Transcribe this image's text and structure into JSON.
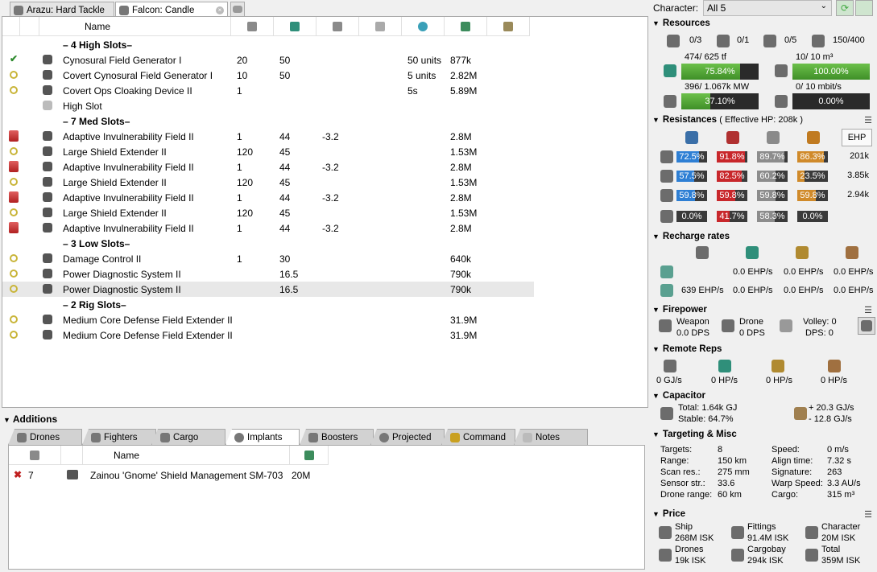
{
  "tabs": [
    {
      "label": "Arazu: Hard Tackle",
      "active": false
    },
    {
      "label": "Falcon: Candle",
      "active": true
    }
  ],
  "fitting": {
    "name_header": "Name",
    "header_icons": [
      "cpu-icon",
      "powergrid-icon",
      "capacitor-icon",
      "speed-icon",
      "range-icon",
      "price-icon",
      "falloff-icon"
    ],
    "rows": [
      {
        "type": "rack",
        "name": "– 4 High Slots–"
      },
      {
        "state": "online-check",
        "name": "Cynosural Field Generator I",
        "c1": "20",
        "c2": "50",
        "c3": "",
        "c5": "50 units",
        "c6": "877k"
      },
      {
        "state": "online",
        "name": "Covert Cynosural Field Generator I",
        "c1": "10",
        "c2": "50",
        "c3": "",
        "c5": "5 units",
        "c6": "2.82M"
      },
      {
        "state": "online",
        "name": "Covert Ops Cloaking Device II",
        "c1": "1",
        "c2": "",
        "c3": "",
        "c5": "5s",
        "c6": "5.89M"
      },
      {
        "state": "",
        "name": "High Slot",
        "c1": "",
        "c2": "",
        "c3": "",
        "c5": "",
        "c6": "",
        "empty": true
      },
      {
        "type": "rack",
        "name": "– 7 Med Slots–"
      },
      {
        "state": "overheat",
        "name": "Adaptive Invulnerability Field II",
        "c1": "1",
        "c2": "44",
        "c3": "-3.2",
        "c5": "",
        "c6": "2.8M"
      },
      {
        "state": "online",
        "name": "Large Shield Extender II",
        "c1": "120",
        "c2": "45",
        "c3": "",
        "c5": "",
        "c6": "1.53M"
      },
      {
        "state": "overheat",
        "name": "Adaptive Invulnerability Field II",
        "c1": "1",
        "c2": "44",
        "c3": "-3.2",
        "c5": "",
        "c6": "2.8M"
      },
      {
        "state": "online",
        "name": "Large Shield Extender II",
        "c1": "120",
        "c2": "45",
        "c3": "",
        "c5": "",
        "c6": "1.53M"
      },
      {
        "state": "overheat",
        "name": "Adaptive Invulnerability Field II",
        "c1": "1",
        "c2": "44",
        "c3": "-3.2",
        "c5": "",
        "c6": "2.8M"
      },
      {
        "state": "online",
        "name": "Large Shield Extender II",
        "c1": "120",
        "c2": "45",
        "c3": "",
        "c5": "",
        "c6": "1.53M"
      },
      {
        "state": "overheat",
        "name": "Adaptive Invulnerability Field II",
        "c1": "1",
        "c2": "44",
        "c3": "-3.2",
        "c5": "",
        "c6": "2.8M"
      },
      {
        "type": "rack",
        "name": "– 3 Low Slots–"
      },
      {
        "state": "online",
        "name": "Damage Control II",
        "c1": "1",
        "c2": "30",
        "c3": "",
        "c5": "",
        "c6": "640k"
      },
      {
        "state": "online",
        "name": "Power Diagnostic System II",
        "c1": "",
        "c2": "16.5",
        "c3": "",
        "c5": "",
        "c6": "790k"
      },
      {
        "state": "online",
        "name": "Power Diagnostic System II",
        "c1": "",
        "c2": "16.5",
        "c3": "",
        "c5": "",
        "c6": "790k",
        "selected": true
      },
      {
        "type": "rack",
        "name": "– 2 Rig Slots–"
      },
      {
        "state": "online",
        "name": "Medium Core Defense Field Extender II",
        "c1": "",
        "c2": "",
        "c3": "",
        "c5": "",
        "c6": "31.9M"
      },
      {
        "state": "online",
        "name": "Medium Core Defense Field Extender II",
        "c1": "",
        "c2": "",
        "c3": "",
        "c5": "",
        "c6": "31.9M"
      }
    ]
  },
  "additions": {
    "title": "Additions",
    "tabs": [
      "Drones",
      "Fighters",
      "Cargo",
      "Implants",
      "Boosters",
      "Projected",
      "Command",
      "Notes"
    ],
    "active_tab": "Implants",
    "implants_header": {
      "name": "Name"
    },
    "implants": [
      {
        "slot": "7",
        "name": "Zainou 'Gnome' Shield Management SM-703",
        "price": "20M"
      }
    ]
  },
  "character": {
    "label": "Character:",
    "value": "All 5"
  },
  "resources": {
    "title": "Resources",
    "hardpoints": [
      "0/3",
      "0/1",
      "0/5",
      "150/400"
    ],
    "cpu": {
      "text": "474/ 625 tf",
      "pct": "75.84%",
      "fill": 0.7584
    },
    "drone_bay": {
      "text": "10/ 10 m³",
      "pct": "100.00%",
      "fill": 1.0
    },
    "powergrid": {
      "text": "396/ 1.067k MW",
      "pct": "37.10%",
      "fill": 0.371
    },
    "bandwidth": {
      "text": "0/ 10 mbit/s",
      "pct": "0.00%",
      "fill": 0.0
    }
  },
  "resistances": {
    "title": "Resistances",
    "ehp_note": "( Effective HP: 208k )",
    "ehp_button": "EHP",
    "rows": [
      {
        "vals": [
          "72.5%",
          "91.8%",
          "89.7%",
          "86.3%"
        ],
        "fills": [
          0.725,
          0.918,
          0.897,
          0.863
        ],
        "hp": "201k"
      },
      {
        "vals": [
          "57.5%",
          "82.5%",
          "60.2%",
          "23.5%"
        ],
        "fills": [
          0.575,
          0.825,
          0.602,
          0.235
        ],
        "hp": "3.85k"
      },
      {
        "vals": [
          "59.8%",
          "59.8%",
          "59.8%",
          "59.8%"
        ],
        "fills": [
          0.598,
          0.598,
          0.598,
          0.598
        ],
        "hp": "2.94k"
      },
      {
        "vals": [
          "0.0%",
          "41.7%",
          "58.3%",
          "0.0%"
        ],
        "fills": [
          0,
          0.417,
          0.583,
          0
        ],
        "hp": ""
      }
    ],
    "colors": [
      "#2e7fd4",
      "#c8272b",
      "#8c8c8c",
      "#d08a2a"
    ]
  },
  "recharge": {
    "title": "Recharge rates",
    "row1": [
      "0.0 EHP/s",
      "0.0 EHP/s",
      "0.0 EHP/s"
    ],
    "row2": [
      "639 EHP/s",
      "0.0 EHP/s",
      "0.0 EHP/s",
      "0.0 EHP/s"
    ]
  },
  "firepower": {
    "title": "Firepower",
    "weapon_label": "Weapon",
    "weapon_dps": "0.0 DPS",
    "drone_label": "Drone",
    "drone_dps": "0 DPS",
    "volley": "Volley: 0",
    "dps": "DPS: 0"
  },
  "remote_reps": {
    "title": "Remote Reps",
    "values": [
      "0 GJ/s",
      "0 HP/s",
      "0 HP/s",
      "0 HP/s"
    ]
  },
  "capacitor": {
    "title": "Capacitor",
    "total": "Total: 1.64k GJ",
    "stable": "Stable: 64.7%",
    "plus": "+ 20.3 GJ/s",
    "minus": "- 12.8 GJ/s"
  },
  "targeting": {
    "title": "Targeting & Misc",
    "left": [
      [
        "Targets:",
        "8"
      ],
      [
        "Range:",
        "150 km"
      ],
      [
        "Scan res.:",
        "275 mm"
      ],
      [
        "Sensor str.:",
        "33.6"
      ],
      [
        "Drone range:",
        "60 km"
      ]
    ],
    "right": [
      [
        "Speed:",
        "0 m/s"
      ],
      [
        "Align time:",
        "7.32 s"
      ],
      [
        "Signature:",
        "263"
      ],
      [
        "Warp Speed:",
        "3.3 AU/s"
      ],
      [
        "Cargo:",
        "315 m³"
      ]
    ]
  },
  "price": {
    "title": "Price",
    "items": [
      [
        "Ship",
        "268M ISK"
      ],
      [
        "Fittings",
        "91.4M ISK"
      ],
      [
        "Character",
        "20M ISK"
      ],
      [
        "Drones",
        "19k ISK"
      ],
      [
        "Cargobay",
        "294k ISK"
      ],
      [
        "Total",
        "359M ISK"
      ]
    ]
  }
}
